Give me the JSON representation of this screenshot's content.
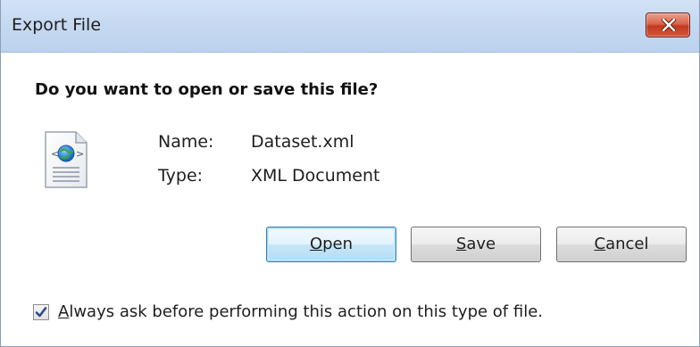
{
  "window": {
    "title": "Export File",
    "close_icon": "close-icon"
  },
  "dialog": {
    "prompt": "Do you want to open or save this file?",
    "file_icon": "xml-document-icon",
    "name_label": "Name:",
    "name_value": "Dataset.xml",
    "type_label": "Type:",
    "type_value": "XML Document"
  },
  "buttons": {
    "open": {
      "mnemonic": "O",
      "rest": "pen"
    },
    "save": {
      "mnemonic": "S",
      "rest": "ave"
    },
    "cancel": {
      "mnemonic": "C",
      "rest": "ancel"
    },
    "default": "open"
  },
  "always_ask": {
    "checked": true,
    "mnemonic": "A",
    "rest": "lways ask before performing this action on this type of file."
  },
  "colors": {
    "titlebar": "#c6d9f1",
    "close_button": "#c3391e",
    "default_button_border": "#3c7fb1",
    "checkmark": "#2a4d8a"
  }
}
